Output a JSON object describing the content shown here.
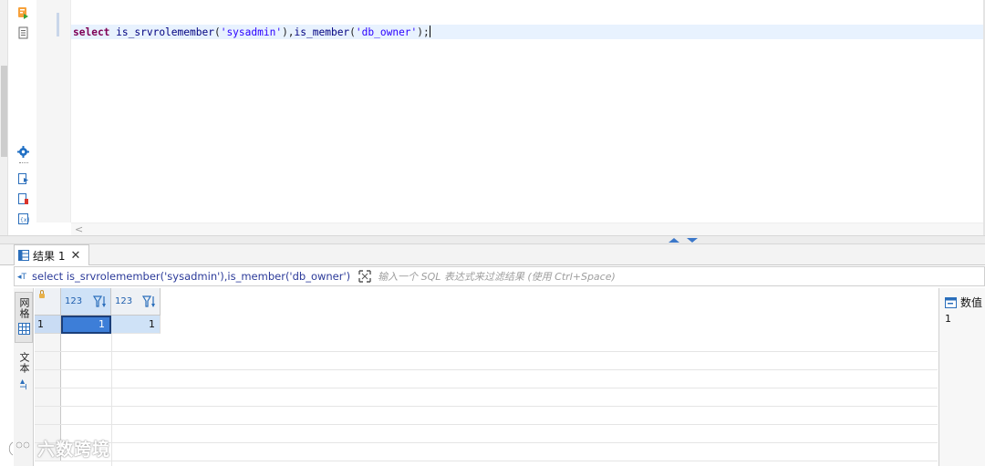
{
  "editor": {
    "sql_tokens": {
      "kw_select": "select",
      "fn1": "is_srvrolemember",
      "p1": "(",
      "str1": "'sysadmin'",
      "p2": "),",
      "fn2": "is_member",
      "p3": "(",
      "str2": "'db_owner'",
      "p4": ");"
    },
    "scroll_left_glyph": "<"
  },
  "toolbar": {
    "icons": [
      "execute-icon",
      "explain-icon",
      "settings-gear-icon",
      "export-icon",
      "script-error-icon",
      "variables-icon"
    ]
  },
  "results": {
    "tab_label": "结果 1",
    "tab_close": "✕",
    "query_text": "select is_srvrolemember('sysadmin'),is_member('db_owner')",
    "filter_placeholder": "输入一个 SQL 表达式来过滤结果 (使用 Ctrl+Space)",
    "vtab_grid": "网格",
    "vtab_text": "文本",
    "columns": [
      {
        "type": "123"
      },
      {
        "type": "123"
      }
    ],
    "rows": [
      {
        "num": "1",
        "cells": [
          "1",
          "1"
        ]
      }
    ],
    "value_panel_title": "数值",
    "value_panel_value": "1"
  },
  "watermark": {
    "text": "六数跨境"
  },
  "colors": {
    "accent": "#3d7ed8",
    "keyword": "#7f0055",
    "string": "#2a00ff",
    "query_text": "#2b3a99"
  }
}
